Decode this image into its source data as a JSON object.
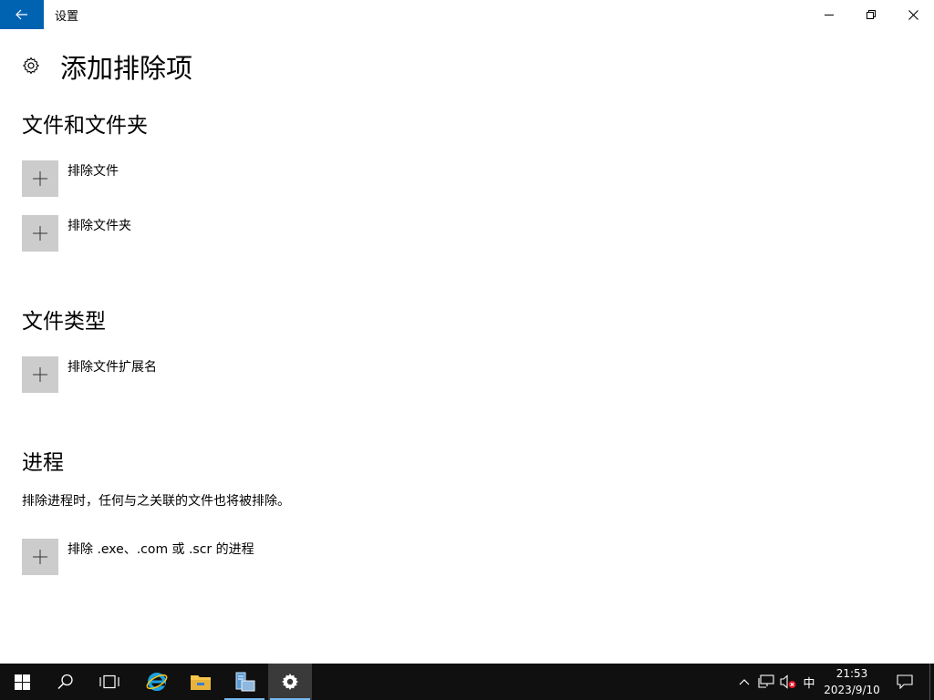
{
  "window": {
    "title": "设置"
  },
  "page": {
    "title": "添加排除项"
  },
  "sections": {
    "files": {
      "title": "文件和文件夹",
      "items": [
        "排除文件",
        "排除文件夹"
      ]
    },
    "types": {
      "title": "文件类型",
      "items": [
        "排除文件扩展名"
      ]
    },
    "processes": {
      "title": "进程",
      "description": "排除进程时，任何与之关联的文件也将被排除。",
      "items": [
        "排除 .exe、.com 或 .scr 的进程"
      ]
    }
  },
  "taskbar": {
    "ime": "中",
    "time": "21:53",
    "date": "2023/9/10",
    "active_accent": "#76b9ed"
  },
  "colors": {
    "accent": "#0063b1",
    "add_box": "#cccccc",
    "taskbar": "#101010"
  }
}
